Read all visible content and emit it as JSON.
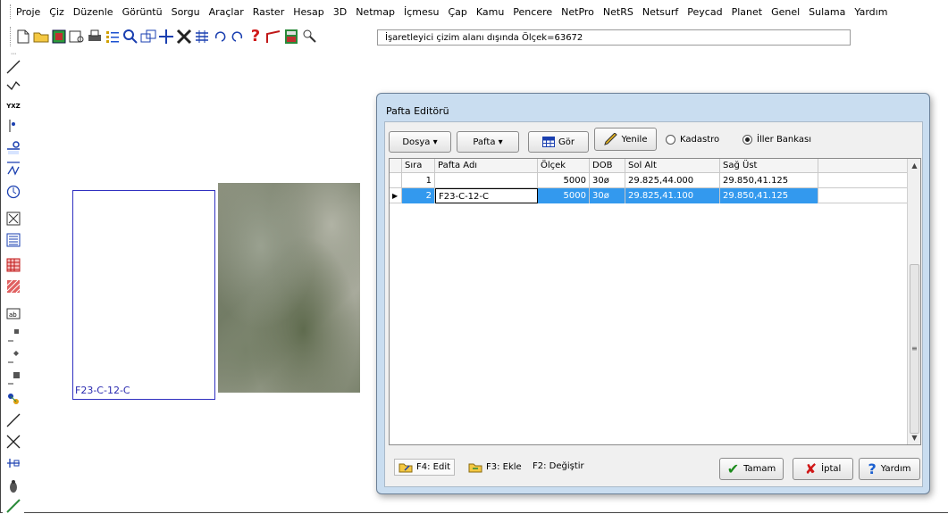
{
  "menu": [
    "Proje",
    "Çiz",
    "Düzenle",
    "Görüntü",
    "Sorgu",
    "Araçlar",
    "Raster",
    "Hesap",
    "3D",
    "Netmap",
    "İçmesu",
    "Çap",
    "Kamu",
    "Pencere",
    "NetPro",
    "NetRS",
    "Netsurf",
    "Peycad",
    "Planet",
    "Genel",
    "Sulama",
    "Yardım"
  ],
  "status_text": "İşaretleyici çizim alanı dışında Ölçek=63672",
  "canvas": {
    "parcel_label": "F23-C-12-C"
  },
  "dialog": {
    "title": "Pafta Editörü",
    "toolbar": {
      "dosya": "Dosya ▾",
      "pafta": "Pafta ▾",
      "gor": "Gör",
      "yenile": "Yenile",
      "kadastro": "Kadastro",
      "iller_bankasi": "İller Bankası"
    },
    "columns": [
      "Sıra",
      "Pafta Adı",
      "Ölçek",
      "DOB",
      "Sol Alt",
      "Sağ Üst"
    ],
    "rows": [
      {
        "sira": "1",
        "pafta_adi": "",
        "olcek": "5000",
        "dob": "30ø",
        "sol_alt": "29.825,44.000",
        "sag_ust": "29.850,41.125"
      },
      {
        "sira": "2",
        "pafta_adi": "F23-C-12-C",
        "olcek": "5000",
        "dob": "30ø",
        "sol_alt": "29.825,41.100",
        "sag_ust": "29.850,41.125"
      }
    ],
    "bottom": {
      "f4": "F4: Edit",
      "f3": "F3: Ekle",
      "f2": "F2: Değiştir",
      "tamam": "Tamam",
      "iptal": "İptal",
      "yardim": "Yardım"
    }
  },
  "colors": {
    "selection": "#3399ee",
    "dialog_frame": "#c9ddf0",
    "parcel_outline": "#3030c0"
  }
}
